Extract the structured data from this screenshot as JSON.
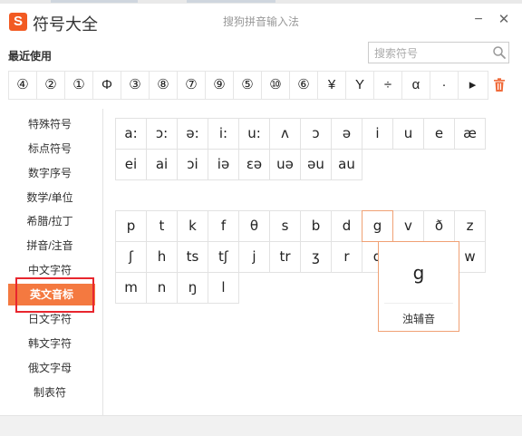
{
  "window": {
    "title": "符号大全",
    "subtitle": "搜狗拼音输入法",
    "brand_color": "#f25a22",
    "logo_letter": "S",
    "minimize_icon": "minimize-icon",
    "close_icon": "close-icon"
  },
  "recent": {
    "label": "最近使用",
    "symbols": [
      "④",
      "②",
      "①",
      "Φ",
      "③",
      "⑧",
      "⑦",
      "⑨",
      "⑤",
      "⑩",
      "⑥",
      "¥",
      "Y",
      "÷",
      "α",
      "·",
      "▸"
    ],
    "delete_icon": "trash-icon"
  },
  "search": {
    "placeholder": "搜索符号",
    "icon": "search-icon"
  },
  "sidebar": {
    "items": [
      {
        "label": "特殊符号"
      },
      {
        "label": "标点符号"
      },
      {
        "label": "数字序号"
      },
      {
        "label": "数学/单位"
      },
      {
        "label": "希腊/拉丁"
      },
      {
        "label": "拼音/注音"
      },
      {
        "label": "中文字符"
      },
      {
        "label": "英文音标"
      },
      {
        "label": "日文字符"
      },
      {
        "label": "韩文字符"
      },
      {
        "label": "俄文字母"
      },
      {
        "label": "制表符"
      }
    ],
    "active_index": 7,
    "active_color": "#f47940",
    "highlight_color": "#e8262e"
  },
  "vowels": [
    "a:",
    "ɔ:",
    "ə:",
    "i:",
    "u:",
    "ʌ",
    "ɔ",
    "ə",
    "i",
    "u",
    "e",
    "æ",
    "ei",
    "ai",
    "ɔi",
    "iə",
    "ɛə",
    "uə",
    "əu",
    "au"
  ],
  "consonants": [
    "p",
    "t",
    "k",
    "f",
    "θ",
    "s",
    "b",
    "d",
    "g",
    "v",
    "ð",
    "z",
    "ʃ",
    "h",
    "ts",
    "tʃ",
    "j",
    "tr",
    "ʒ",
    "r",
    "d",
    "",
    "",
    "w",
    "m",
    "n",
    "ŋ",
    "l"
  ],
  "tooltip": {
    "glyph": "g",
    "description": "浊辅音"
  }
}
